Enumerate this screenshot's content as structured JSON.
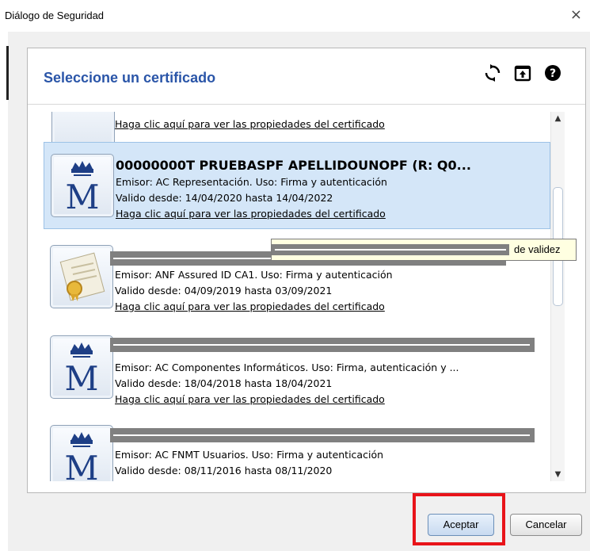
{
  "window": {
    "title": "Diálogo de Seguridad",
    "close_glyph": "×"
  },
  "panel": {
    "title": "Seleccione un certificado",
    "toolbar_icons": [
      "refresh-icon",
      "open-file-icon",
      "help-icon"
    ]
  },
  "certificates": [
    {
      "link": "Haga clic aquí para ver las propiedades del certificado"
    },
    {
      "name": "00000000T PRUEBASPF APELLIDOUNOPF (R: Q0...",
      "issuer": "Emisor: AC Representación. Uso: Firma y autenticación",
      "validity": "Valido desde: 14/04/2020 hasta 14/04/2022",
      "link": "Haga clic aquí para ver las propiedades del certificado",
      "icon": "fnmt-crown-icon"
    },
    {
      "issuer": "Emisor: ANF Assured ID CA1. Uso: Firma y autenticación",
      "validity": "Valido desde: 04/09/2019 hasta 03/09/2021",
      "link": "Haga clic aquí para ver las propiedades del certificado",
      "icon": "certificate-seal-icon"
    },
    {
      "issuer": "Emisor: AC Componentes Informáticos. Uso: Firma, autenticación y ...",
      "validity": "Valido desde: 18/04/2018 hasta 18/04/2021",
      "link": "Haga clic aquí para ver las propiedades del certificado",
      "icon": "fnmt-crown-icon"
    },
    {
      "issuer": "Emisor: AC FNMT Usuarios. Uso: Firma y autenticación",
      "validity": "Valido desde: 08/11/2016 hasta 08/11/2020",
      "icon": "fnmt-crown-icon"
    }
  ],
  "tooltip": {
    "text": "de validez"
  },
  "buttons": {
    "accept": "Aceptar",
    "cancel": "Cancelar"
  },
  "colors": {
    "title_blue": "#2a55a8",
    "selection_bg": "#d4e6f8",
    "highlight_red": "#e8141a",
    "redaction_gray": "#808080"
  }
}
